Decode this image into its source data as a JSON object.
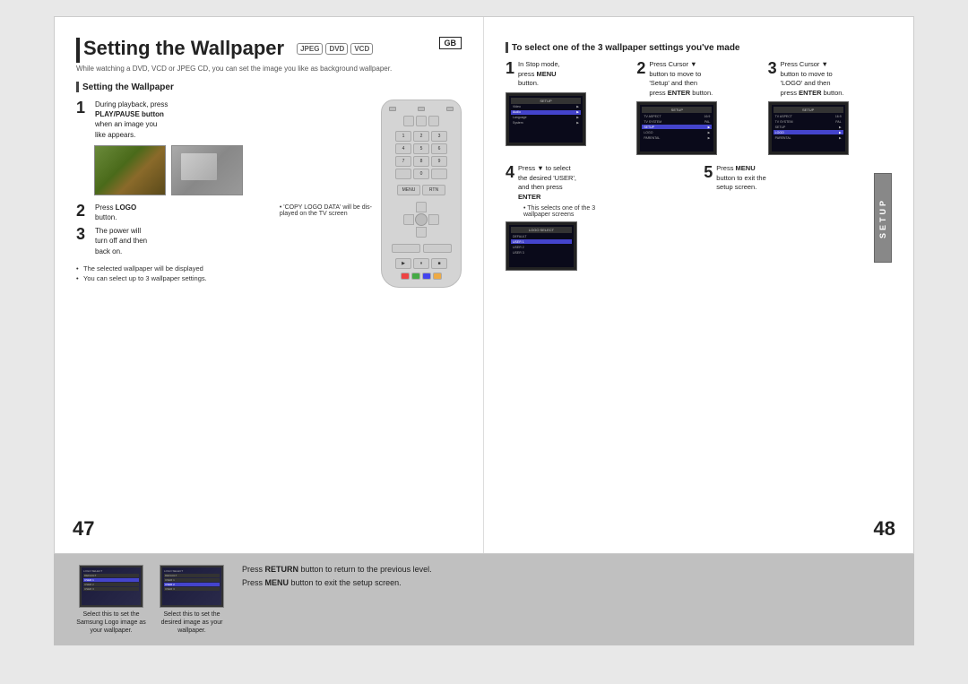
{
  "title": "Setting the Wallpaper",
  "formats": [
    "JPEG",
    "DVD",
    "VCD"
  ],
  "gb_label": "GB",
  "subtitle": "While watching a DVD, VCD or JPEG CD, you can set the image you like as background wallpaper.",
  "left_section": {
    "header": "Setting the Wallpaper",
    "steps": [
      {
        "number": "1",
        "text": "During playback, press",
        "text2": "PLAY/PAUSE button",
        "text3": "when an image you",
        "text4": "like appears."
      },
      {
        "number": "2",
        "text": "Press ",
        "bold": "LOGO",
        "text2": " button."
      },
      {
        "number": "3",
        "text": "The power will turn off and then back on."
      }
    ],
    "note1": "* 'COPY LOGO DATA' will be displayed on the TV screen",
    "bullet_notes": [
      "The selected wallpaper will be displayed",
      "You can select up to 3 wallpaper settings."
    ]
  },
  "right_section": {
    "header": "To select one of the 3 wallpaper settings you've made",
    "steps": [
      {
        "number": "1",
        "text": "In Stop mode, press ",
        "bold": "MENU",
        "text2": " button."
      },
      {
        "number": "2",
        "text": "Press Cursor ▼ button to move to 'Setup' and then press ",
        "bold": "ENTER",
        "text2": " button."
      },
      {
        "number": "3",
        "text": "Press Cursor ▼ button to move to 'LOGO' and then press ",
        "bold": "ENTER",
        "text2": " button."
      },
      {
        "number": "4",
        "text": "Press ▼ to select the desired 'USER', and then press ",
        "bold": "ENTER"
      },
      {
        "number": "5",
        "text": "Press ",
        "bold": "MENU",
        "text2": " button to exit the setup screen."
      }
    ],
    "note": "• This selects one of the 3 wallpaper screens"
  },
  "setup_tab": "SETUP",
  "bottom": {
    "thumb1_label": "Select this to set the Samsung Logo image as your wallpaper.",
    "thumb2_label": "Select this to set the desired image as your wallpaper.",
    "note1": "Press RETURN button to return to the previous level.",
    "note2": "Press MENU button to exit the setup screen."
  },
  "page_numbers": {
    "left": "47",
    "right": "48"
  }
}
